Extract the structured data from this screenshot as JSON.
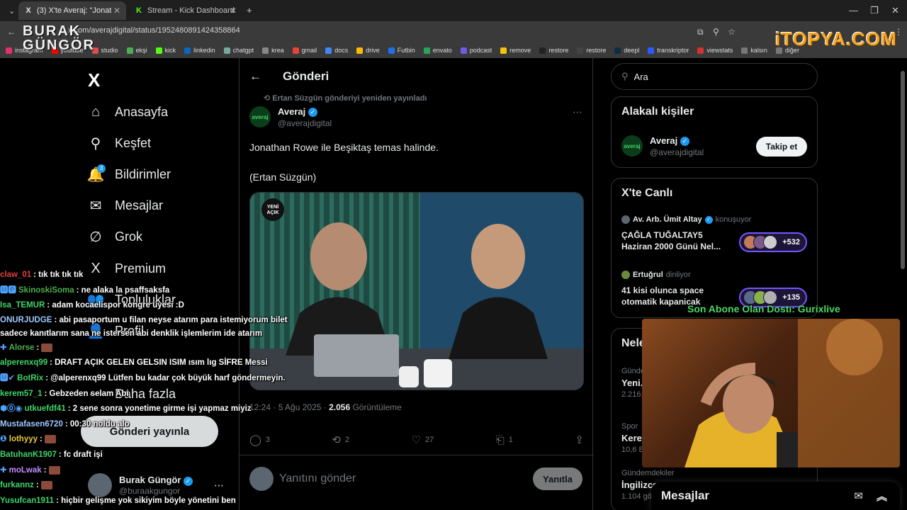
{
  "browser": {
    "tabs": [
      {
        "title": "(3) X'te Averaj: \"Jonathan R...",
        "favicon": "X"
      },
      {
        "title": "Stream - Kick Dashboard",
        "favicon": "K"
      }
    ],
    "url": "x.com/averajdigital/status/1952480891424358864",
    "bookmarks": [
      "instagram",
      "youtube",
      "studio",
      "ekşi",
      "kick",
      "linkedin",
      "chatgpt",
      "krea",
      "gmail",
      "docs",
      "drive",
      "Futbin",
      "envato",
      "podcast",
      "remove",
      "restore",
      "restore",
      "deepl",
      "transkriptor",
      "viewstats",
      "kalsın",
      "diğer"
    ],
    "bookmark_colors": [
      "#e1306c",
      "#ff0000",
      "#e04b4b",
      "#4caf50",
      "#53fc18",
      "#0a66c2",
      "#74aa9c",
      "#888",
      "#ea4335",
      "#4285f4",
      "#fbbc04",
      "#1a73e8",
      "#2ba360",
      "#6c5ce7",
      "#f1c40f",
      "#222",
      "#444",
      "#0f2b46",
      "#2e5bff",
      "#d63031",
      "#777",
      "#777"
    ]
  },
  "overlay": {
    "brand_left_line1": "BURAK",
    "brand_left_line2": "GÜNGÖR",
    "brand_right": "iTOPYA.COM",
    "sub_notice": "Son Abone Olan Dostı: Gurixlive"
  },
  "nav": {
    "logo": "X",
    "items": [
      {
        "label": "Anasayfa",
        "icon": "home-icon",
        "glyph": "⌂"
      },
      {
        "label": "Keşfet",
        "icon": "search-icon",
        "glyph": "⚲"
      },
      {
        "label": "Bildirimler",
        "icon": "bell-icon",
        "glyph": "🔔"
      },
      {
        "label": "Mesajlar",
        "icon": "mail-icon",
        "glyph": "✉"
      },
      {
        "label": "Grok",
        "icon": "grok-icon",
        "glyph": "∅"
      },
      {
        "label": "Premium",
        "icon": "premium-x-icon",
        "glyph": "X"
      },
      {
        "label": "Topluluklar",
        "icon": "communities-icon",
        "glyph": "👥"
      },
      {
        "label": "Profil",
        "icon": "profile-icon",
        "glyph": "👤"
      },
      {
        "label": "Daha fazla",
        "icon": "more-icon",
        "glyph": "⋯"
      }
    ],
    "notifications_badge": "3",
    "post_button": "Gönderi yayınla",
    "account_name": "Burak Güngör",
    "account_handle": "@buraakgungor"
  },
  "main": {
    "header": "Gönderi",
    "repost_note": "Ertan Süzgün gönderiyi yeniden yayınladı",
    "author_name": "Averaj",
    "author_handle": "@averajdigital",
    "avatar_text": "averaj",
    "text_line1": "Jonathan Rowe ile Beşiktaş temas halinde.",
    "text_line2": "(Ertan Süzgün)",
    "media_watermark": "YENİ AÇIK",
    "time": "12:24 · 5 Ağu 2025 · ",
    "views_count": "2.056",
    "views_label": "Görüntüleme",
    "replies": "3",
    "reposts": "2",
    "likes": "27",
    "bookmarks": "1",
    "reply_placeholder": "Yanıtını gönder",
    "reply_button": "Yanıtla"
  },
  "right": {
    "search_placeholder": "Ara",
    "related_title": "Alakalı kişiler",
    "related_name": "Averaj",
    "related_handle": "@averajdigital",
    "follow_button": "Takip et",
    "live_title": "X'te Canlı",
    "spaces": [
      {
        "host": "Av. Arb. Ümit Altay",
        "status": "konuşuyor",
        "title_line1": "ÇAĞLA TUĞALTAY5",
        "title_line2": "Haziran 2000 Günü Nel...",
        "count": "+532"
      },
      {
        "host": "Ertuğrul",
        "status": "dinliyor",
        "title_line1": "41 kisi olunca space",
        "title_line2": "otomatik kapanicak",
        "count": "+135"
      }
    ],
    "news_title": "Neler oluyor",
    "news": [
      {
        "cat": "Gündem",
        "title": "Yeni...",
        "meta": "2.216..."
      },
      {
        "cat": "Spor",
        "title": "Kere...",
        "meta": "10,6 B..."
      },
      {
        "cat": "Gündemdekiler",
        "title": "İngilizce...",
        "meta": "1.104 gönderi"
      }
    ],
    "dm_title": "Mesajlar"
  },
  "chat": [
    {
      "user": "claw_01",
      "color": "#e04040",
      "text": "tık tık tık tık",
      "badges": ""
    },
    {
      "user": "SkinoskiSoma",
      "color": "#4caf50",
      "text": "ne alaka la psaffsaksfa",
      "badges": "🅼🅿"
    },
    {
      "user": "Isa_TEMUR",
      "color": "#3fd46a",
      "text": "adam kocaelispor kongre üyesi :D",
      "badges": ""
    },
    {
      "user": "ONURJUDGE",
      "color": "#9ec8ff",
      "text": "abi pasaportum u filan neyse atarım para istemiyorum bilet sadece kanıtlarım sana ne istersen abi denklik işlemlerim ide atarım",
      "badges": "",
      "wrap": true
    },
    {
      "user": "Alorse",
      "color": "#4caf50",
      "text": "",
      "badges": "✚",
      "emote": true
    },
    {
      "user": "alperenxq99",
      "color": "#3fd46a",
      "text": "DRAFT AÇIK GELEN GELSIN ISIM ısım lıg SİFRE Messi",
      "badges": ""
    },
    {
      "user": "BotRix",
      "color": "#3fd46a",
      "text": "@alperenxq99 Lütfen bu kadar çok büyük harf göndermeyin.",
      "badges": "🅼✔"
    },
    {
      "user": "kerem57_1",
      "color": "#3fd46a",
      "text": "Gebzeden selam Abi",
      "badges": ""
    },
    {
      "user": "utkuefdf41",
      "color": "#3fd46a",
      "text": "2 sene sonra yonetime girme işi yapmaz miyiz",
      "badges": "⬢⓪◉"
    },
    {
      "user": "Mustafasen6720",
      "color": "#9ec8ff",
      "text": "00:30 noldu alo",
      "badges": ""
    },
    {
      "user": "lothyyy",
      "color": "#e8c83a",
      "text": "",
      "badges": "❶",
      "emote": true
    },
    {
      "user": "BatuhanK1907",
      "color": "#3fd46a",
      "text": "fc draft işi",
      "badges": ""
    },
    {
      "user": "moLwak",
      "color": "#c58cff",
      "text": "",
      "badges": "✚",
      "emote": true
    },
    {
      "user": "furkannz",
      "color": "#3fd46a",
      "text": "",
      "badges": "",
      "emote": true
    },
    {
      "user": "Yusufcan1911",
      "color": "#3fd46a",
      "text": "hiçbir gelişme yok sikiyim böyle yönetini ben",
      "badges": ""
    }
  ]
}
